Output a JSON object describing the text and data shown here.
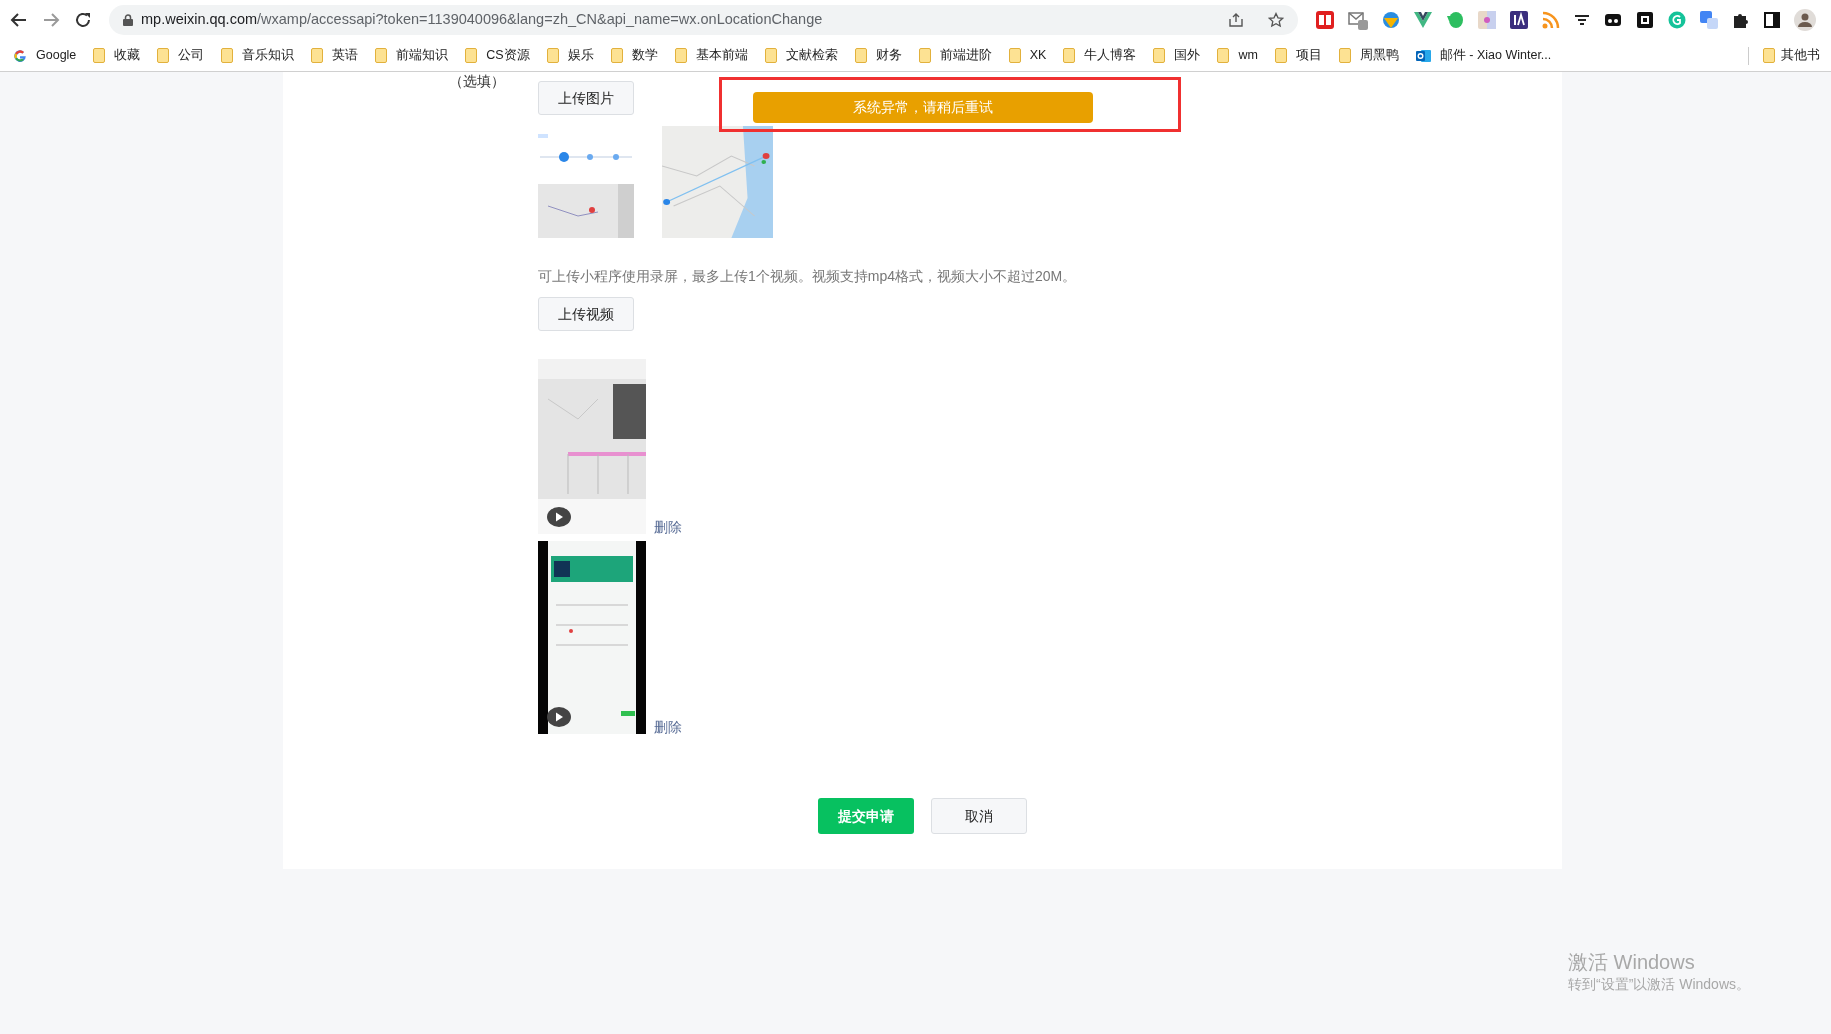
{
  "browser": {
    "url_host": "mp.weixin.qq.com",
    "url_path": "/wxamp/accessapi?token=1139040096&lang=zh_CN&api_name=wx.onLocationChange"
  },
  "bookmarks": [
    {
      "kind": "google",
      "label": "Google"
    },
    {
      "kind": "folder",
      "label": "收藏"
    },
    {
      "kind": "folder",
      "label": "公司"
    },
    {
      "kind": "folder",
      "label": "音乐知识"
    },
    {
      "kind": "folder",
      "label": "英语"
    },
    {
      "kind": "folder",
      "label": "前端知识"
    },
    {
      "kind": "folder",
      "label": "CS资源"
    },
    {
      "kind": "folder",
      "label": "娱乐"
    },
    {
      "kind": "folder",
      "label": "数学"
    },
    {
      "kind": "folder",
      "label": "基本前端"
    },
    {
      "kind": "folder",
      "label": "文献检索"
    },
    {
      "kind": "folder",
      "label": "财务"
    },
    {
      "kind": "folder",
      "label": "前端进阶"
    },
    {
      "kind": "folder",
      "label": "XK"
    },
    {
      "kind": "folder",
      "label": "牛人博客"
    },
    {
      "kind": "folder",
      "label": "国外"
    },
    {
      "kind": "folder",
      "label": "wm"
    },
    {
      "kind": "folder",
      "label": "项目"
    },
    {
      "kind": "folder",
      "label": "周黑鸭"
    },
    {
      "kind": "mail",
      "label": "邮件 - Xiao Winter..."
    }
  ],
  "other_bookmarks": "其他书",
  "form": {
    "optional_label": "（选填）",
    "upload_image_button": "上传图片",
    "video_hint": "可上传小程序使用录屏，最多上传1个视频。视频支持mp4格式，视频大小不超过20M。",
    "upload_video_button": "上传视频",
    "videos": [
      {
        "kind": "map",
        "delete": "删除"
      },
      {
        "kind": "phone",
        "delete": "删除"
      }
    ],
    "submit_button": "提交申请",
    "cancel_button": "取消"
  },
  "toast": "系统异常，请稍后重试",
  "os_watermark": {
    "title": "激活 Windows",
    "subtitle": "转到“设置”以激活 Windows。"
  }
}
